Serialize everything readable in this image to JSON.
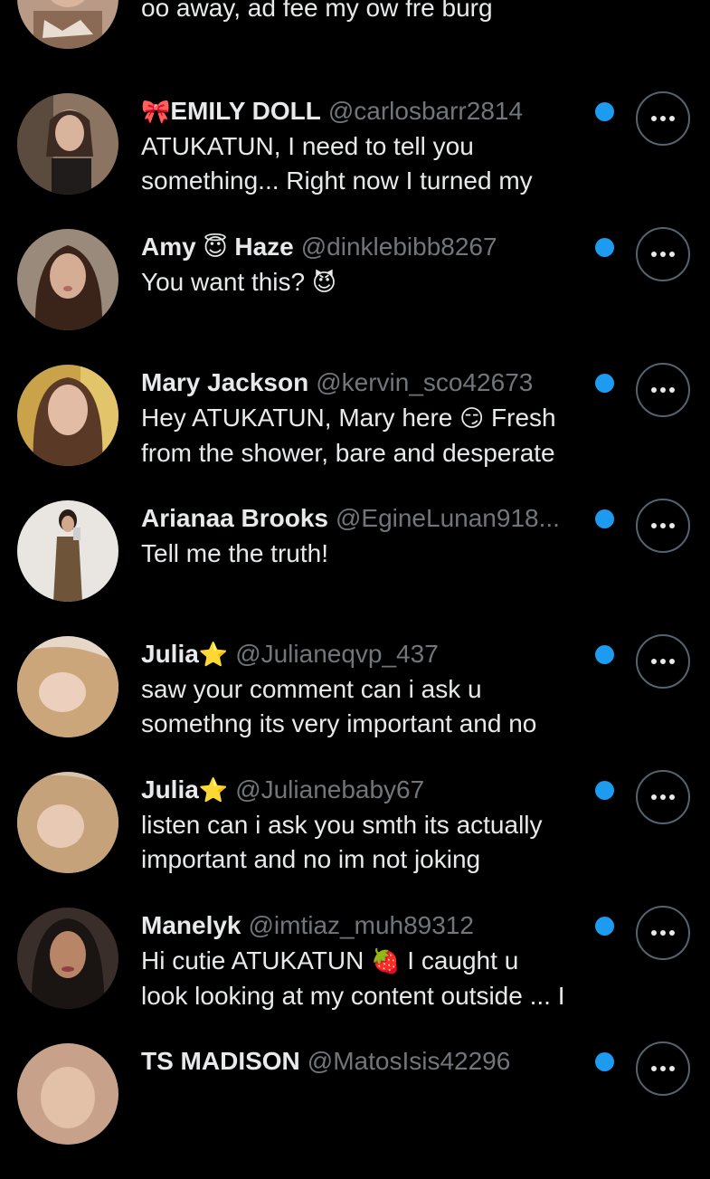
{
  "colors": {
    "background": "#000000",
    "text_primary": "#e7e9ea",
    "text_secondary": "#71767b",
    "unread_dot": "#1d9bf0",
    "button_border": "#536471"
  },
  "conversations": [
    {
      "display_name": "",
      "handle": "",
      "preview": "Enviou um link para você: ow that ca't\noo away, ad  fee my ow fre burg",
      "unread": false,
      "avatar_icon": "profile-photo"
    },
    {
      "name_prefix_emoji": "🎀",
      "display_name": "EMILY DOLL",
      "handle": "@carlosbarr2814",
      "preview": "ATUKATUN, I need to tell you\nsomething... Right now I turned my",
      "unread": true,
      "avatar_icon": "profile-photo"
    },
    {
      "display_name": "Amy",
      "name_emoji": "😇",
      "display_name_suffix": "Haze",
      "handle": "@dinklebibb8267",
      "preview": "You want this?",
      "preview_emoji": "😈",
      "unread": true,
      "avatar_icon": "profile-photo"
    },
    {
      "display_name": "Mary Jackson",
      "handle": "@kervin_sco42673",
      "preview_part1": "Hey ATUKATUN, Mary here",
      "preview_emoji": "😏",
      "preview_part2": "Fresh\nfrom the shower, bare and desperate",
      "unread": true,
      "avatar_icon": "profile-photo"
    },
    {
      "display_name": "Arianaa Brooks",
      "handle": "@EgineLunan918...",
      "preview": "Tell me the truth!",
      "unread": true,
      "avatar_icon": "profile-photo"
    },
    {
      "display_name": "Julia",
      "name_emoji": "⭐",
      "handle": "@Julianeqvp_437",
      "preview": "saw your comment can i ask u\nsomethng its very important and no",
      "unread": true,
      "avatar_icon": "profile-photo"
    },
    {
      "display_name": "Julia",
      "name_emoji": "⭐",
      "handle": "@Julianebaby67",
      "preview": "listen can i ask you smth its actually\nimportant and no im not joking",
      "unread": true,
      "avatar_icon": "profile-photo"
    },
    {
      "display_name": "Manelyk",
      "handle": "@imtiaz_muh89312",
      "preview_part1": "Hi cutie ATUKATUN",
      "preview_emoji": "🍓",
      "preview_part2": "I caught u\nlook looking at my content outside ... I",
      "unread": true,
      "avatar_icon": "profile-photo"
    },
    {
      "display_name": "TS MADISON",
      "handle": "@MatosIsis42296",
      "preview": "",
      "unread": true,
      "avatar_icon": "profile-photo"
    }
  ],
  "more_button_icon": "more-horizontal-icon"
}
